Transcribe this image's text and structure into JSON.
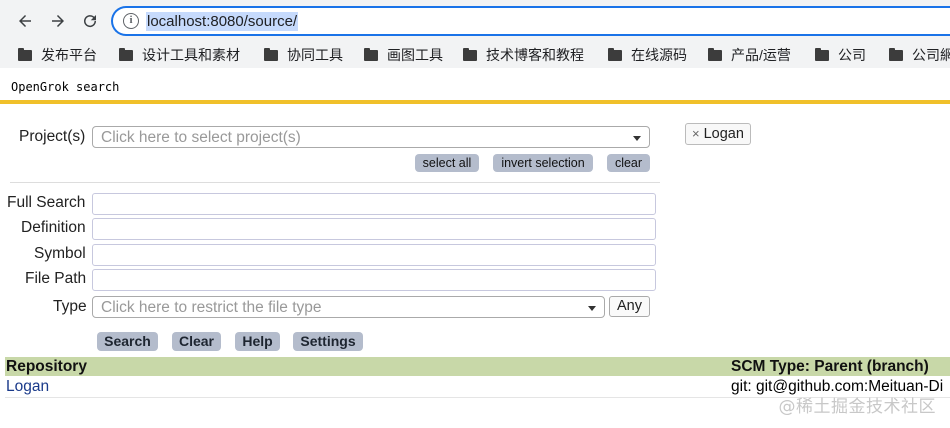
{
  "browser": {
    "url": "localhost:8080/source/",
    "bookmarks": [
      "发布平台",
      "设计工具和素材",
      "协同工具",
      "画图工具",
      "技术博客和教程",
      "在线源码",
      "产品/运营",
      "公司",
      "公司網"
    ]
  },
  "page": {
    "title": "OpenGrok search"
  },
  "project": {
    "label": "Project(s)",
    "placeholder": "Click here to select project(s)",
    "select_all": "select all",
    "invert_selection": "invert selection",
    "clear": "clear",
    "selected_token": "Logan",
    "token_remove": "×"
  },
  "form": {
    "full_search_label": "Full Search",
    "definition_label": "Definition",
    "symbol_label": "Symbol",
    "file_path_label": "File Path",
    "type_label": "Type",
    "type_placeholder": "Click here to restrict the file type",
    "type_value": "Any",
    "full_search_value": "",
    "definition_value": "",
    "symbol_value": "",
    "file_path_value": ""
  },
  "buttons": {
    "search": "Search",
    "clear": "Clear",
    "help": "Help",
    "settings": "Settings"
  },
  "table": {
    "headers": [
      "Repository",
      "SCM Type: Parent (branch)"
    ],
    "rows": [
      {
        "repository": "Logan",
        "scm": "git: git@github.com:Meituan-Di"
      }
    ]
  },
  "watermark": "@稀土掘金技术社区",
  "colors": {
    "accent_line": "#f0c02a",
    "table_header": "#c8d8a8",
    "button_bg": "#b4bccc",
    "link": "#1a3a8a",
    "omnibox_border": "#1a73e8"
  }
}
